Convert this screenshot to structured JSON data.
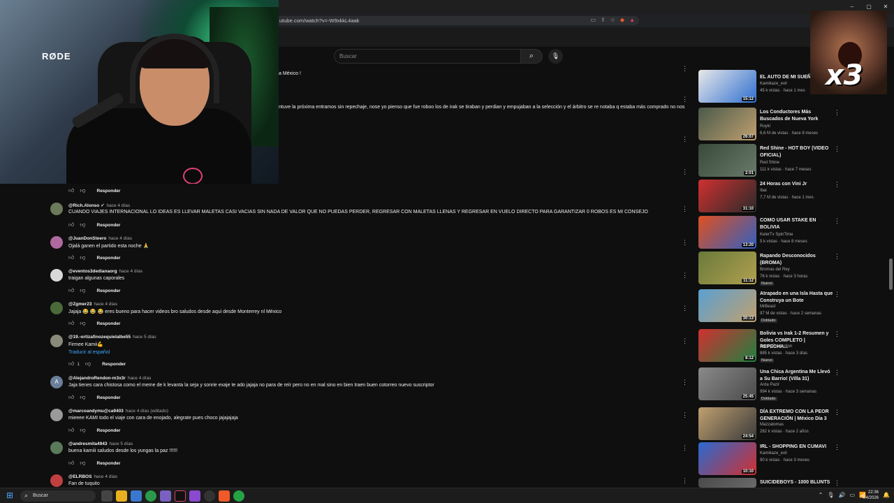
{
  "browser": {
    "url": "utube.com/watch?v=-W9xkkL4aak",
    "window_controls": [
      "–",
      "▢",
      "✕"
    ]
  },
  "yt_header": {
    "search_placeholder": "Buscar"
  },
  "webcam": {
    "mic_brand": "RØDE"
  },
  "overlay": {
    "multiplier": "x3"
  },
  "fragments": {
    "line1": "a México !",
    "line2": "ntuve la próxima entramos sin repechaje, nose yo pienso que fue roboo los de irak se tiraban y perdian y empujaban a la selección y el árbitro se re notaba q estaba más comprado no nos"
  },
  "comment_ui": {
    "reply_label": "Responder",
    "translate_label": "Traducir al español"
  },
  "comments": [
    {
      "handle": "@Rich.Alonso",
      "verified": true,
      "time": "hace 4 días",
      "text": "CUANDO VIAJES INTERNACIONAL LO IDEAS ES LLEVAR MALETAS CASI VACIAS SIN NADA DE VALOR QUE NO PUEDAS PERDER, REGRESAR CON MALETAS LLENAS Y REGRESAR EN VUELO DIRECTO PARA GARANTIZAR 0 ROBOS ES MI CONSEJO",
      "avatar_color": "#6b7a5a",
      "likes": ""
    },
    {
      "handle": "@JuanDonSteero",
      "time": "hace 4 días",
      "text": "Ojalá ganen el partido esta noche 🙏",
      "avatar_color": "#b06aa0",
      "likes": ""
    },
    {
      "handle": "@eventos3dedianaorg",
      "time": "hace 4 días",
      "text": "traigan algunas caporales",
      "avatar_color": "#d8d8d8",
      "likes": ""
    },
    {
      "handle": "@Zgmer23",
      "time": "hace 4 días",
      "text": "Jajaja 😂 😂 😂 eres bueno para hacer videos bro saludos desde aqui desde Monterrey nl México",
      "avatar_color": "#4a6a3a",
      "likes": ""
    },
    {
      "handle": "@19.-ortizafinozequielalbe55",
      "time": "hace 5 días",
      "text": "Firmee Kamii💪",
      "avatar_color": "#8a8a7a",
      "likes": "1",
      "translate": true
    },
    {
      "handle": "@AlejandroRendon-m3x3r",
      "time": "hace 4 días",
      "text": "Jaja tienes cara chistosa como el meme de k levanta la seja y sonrie exaje te ado jajaja no para de reír pero no en mal sino en bien traen buen cotorreo nuevo suscriptor",
      "avatar_color": "#6a7f9a",
      "avatar_letter": "A",
      "likes": ""
    },
    {
      "handle": "@marcoandymu@ca9403",
      "time": "hace 4 días (editado)",
      "text": "mieeee KAMI todo el viaje con cara de enojado, alegrate pues choco jajajajaja",
      "avatar_color": "#9a9a9a",
      "likes": ""
    },
    {
      "handle": "@andresmita4943",
      "time": "hace 5 días",
      "text": "buena kamiii saludos desde los yungas la paz !!!!!!",
      "avatar_color": "#5a7a5a",
      "likes": ""
    },
    {
      "handle": "@ELRBOS",
      "time": "hace 4 días",
      "text": "Fan de tuquito",
      "avatar_color": "#c04040",
      "likes": ""
    }
  ],
  "recommendations": [
    {
      "title": "EL AUTO DE MI SUEÑO",
      "channel": "Kamikaze_evil",
      "meta": "45 k vistas · hace 1 mes",
      "duration": "15:12",
      "colors": [
        "#e8e8e8",
        "#2f6fd0"
      ]
    },
    {
      "title": "Los Conductores Más Buscados de Nueva York",
      "channel": "Royki",
      "meta": "6,6 M de vistas · hace 8 meses",
      "duration": "26:07",
      "colors": [
        "#4a5a4a",
        "#c0a070"
      ]
    },
    {
      "title": "Red Shine - HOT BOY (VIDEO OFICIAL)",
      "channel": "Red Shine",
      "meta": "111 k vistas · hace 7 meses",
      "duration": "2:01",
      "colors": [
        "#3a4a3a",
        "#6a7a6a"
      ]
    },
    {
      "title": "24 Horas con Vini Jr",
      "channel": "Ibai",
      "meta": "7,7 M de vistas · hace 1 mes",
      "duration": "31:10",
      "colors": [
        "#d03030",
        "#2a2a2a"
      ]
    },
    {
      "title": "COMO USAR STAKE EN BOLIVIA",
      "channel": "KelerTv SpinTime",
      "meta": "5 k vistas · hace 8 meses",
      "duration": "13:20",
      "colors": [
        "#e05020",
        "#3060c0"
      ]
    },
    {
      "title": "Rapando Desconocidos (BROMA)",
      "channel": "Bromas del Rey",
      "meta": "76 k vistas · hace 3 horas",
      "duration": "11:12",
      "badge": "Nuevo",
      "colors": [
        "#6a7a3a",
        "#b0a050"
      ]
    },
    {
      "title": "Atrapado en una Isla Hasta que Construya un Bote",
      "channel": "MrBeast",
      "meta": "97 M de vistas · hace 2 semanas",
      "duration": "30:13",
      "badge": "Doblado",
      "colors": [
        "#5aa0d0",
        "#c0a070"
      ]
    },
    {
      "title": "Bolivia vs Irak 1-2 Resumen y Goles COMPLETO | REPECHA...",
      "channel": "Berd | Production",
      "meta": "885 k vistas · hace 3 días",
      "duration": "8:12",
      "badge": "Nuevo",
      "colors": [
        "#d03030",
        "#208040"
      ]
    },
    {
      "title": "Una Chica Argentina Me Llevó a Su Barrio! (Villa 31)",
      "channel": "Arda Pazir",
      "meta": "994 k vistas · hace 3 semanas",
      "duration": "25:45",
      "badge": "Doblado",
      "colors": [
        "#8a8a8a",
        "#4a4a4a"
      ]
    },
    {
      "title": "DÍA EXTREMO CON LA PEOR GENERACIÓN | México Día 3",
      "channel": "Mazzatomas",
      "meta": "282 k vistas · hace 2 años",
      "duration": "24:54",
      "colors": [
        "#c0a070",
        "#3a3a3a"
      ]
    },
    {
      "title": "IRL - SHOPPING EN CUMAVI",
      "channel": "Kamikaze_evil",
      "meta": "90 k vistas · hace 3 meses",
      "duration": "10:10",
      "colors": [
        "#2a6ad0",
        "#d03030"
      ]
    },
    {
      "title": "SUICIDEBOYS - 1000 BLUNTS",
      "channel": "",
      "meta": "",
      "duration": "",
      "colors": [
        "#4a4a4a",
        "#6a6a6a"
      ]
    }
  ],
  "taskbar": {
    "search_label": "Buscar",
    "time": "22:36",
    "date": "4/4/2026"
  }
}
